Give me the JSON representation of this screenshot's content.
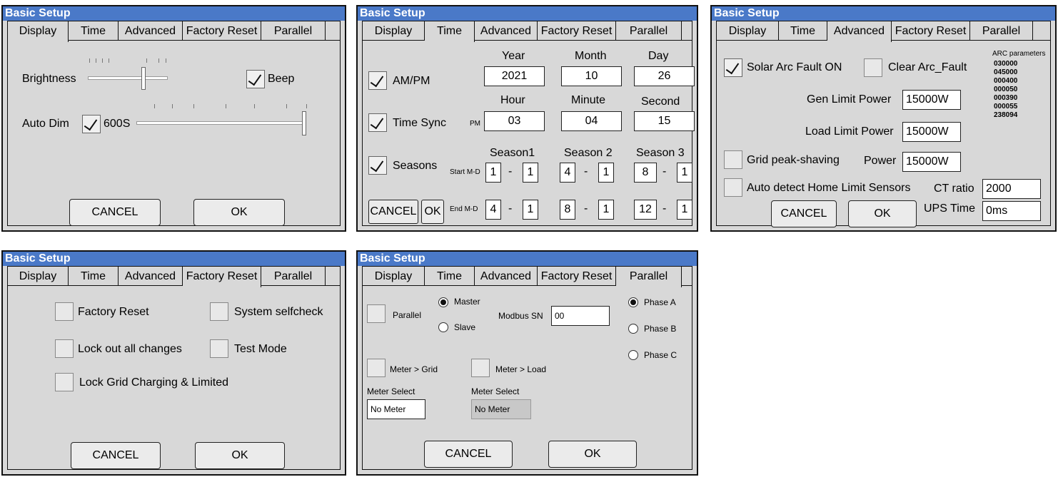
{
  "title": "Basic Setup",
  "tabs": [
    "Display",
    "Time",
    "Advanced",
    "Factory Reset",
    "Parallel"
  ],
  "buttons": {
    "cancel": "CANCEL",
    "ok": "OK"
  },
  "display": {
    "brightness_label": "Brightness",
    "brightness_level": 0.7,
    "beep_label": "Beep",
    "beep_checked": true,
    "auto_dim_label": "Auto Dim",
    "auto_dim_checked": true,
    "auto_dim_value": "600S",
    "auto_dim_level": 1.0
  },
  "time": {
    "ampm_label": "AM/PM",
    "time_sync_label": "Time Sync",
    "seasons_label": "Seasons",
    "year_label": "Year",
    "month_label": "Month",
    "day_label": "Day",
    "year": "2021",
    "month": "10",
    "day": "26",
    "hour_label": "Hour",
    "minute_label": "Minute",
    "second_label": "Second",
    "pm_label": "PM",
    "hour": "03",
    "minute": "04",
    "second": "15",
    "season1_label": "Season1",
    "season2_label": "Season 2",
    "season3_label": "Season 3",
    "start_label": "Start M-D",
    "end_label": "End M-D",
    "dash": "-",
    "s1_start_m": "1",
    "s1_start_d": "1",
    "s2_start_m": "4",
    "s2_start_d": "1",
    "s3_start_m": "8",
    "s3_start_d": "1",
    "s1_end_m": "4",
    "s1_end_d": "1",
    "s2_end_m": "8",
    "s2_end_d": "1",
    "s3_end_m": "12",
    "s3_end_d": "1"
  },
  "advanced": {
    "solar_arc_label": "Solar Arc Fault ON",
    "clear_arc_label": "Clear Arc_Fault",
    "arc_params_label": "ARC parameters",
    "arc_params": [
      "030000",
      "045000",
      "000400",
      "000050",
      "000390",
      "000055",
      "238094"
    ],
    "gen_limit_label": "Gen Limit Power",
    "gen_limit_value": "15000W",
    "load_limit_label": "Load Limit Power",
    "load_limit_value": "15000W",
    "grid_peak_label": "Grid peak-shaving",
    "power_label": "Power",
    "power_value": "15000W",
    "auto_detect_label": "Auto detect Home Limit Sensors",
    "ct_ratio_label": "CT ratio",
    "ct_ratio_value": "2000",
    "ups_time_label": "UPS Time",
    "ups_time_value": "0ms"
  },
  "factory": {
    "factory_reset_label": "Factory Reset",
    "system_selfcheck_label": "System selfcheck",
    "lock_out_label": "Lock out all changes",
    "test_mode_label": "Test Mode",
    "lock_grid_label": "Lock Grid Charging & Limited"
  },
  "parallel": {
    "parallel_label": "Parallel",
    "master_label": "Master",
    "slave_label": "Slave",
    "modbus_label": "Modbus SN",
    "modbus_value": "00",
    "phase_a": "Phase A",
    "phase_b": "Phase B",
    "phase_c": "Phase C",
    "meter_grid_label": "Meter > Grid",
    "meter_load_label": "Meter > Load",
    "meter_select_label": "Meter Select",
    "meter_select1_value": "No Meter",
    "meter_select2_value": "No Meter"
  }
}
